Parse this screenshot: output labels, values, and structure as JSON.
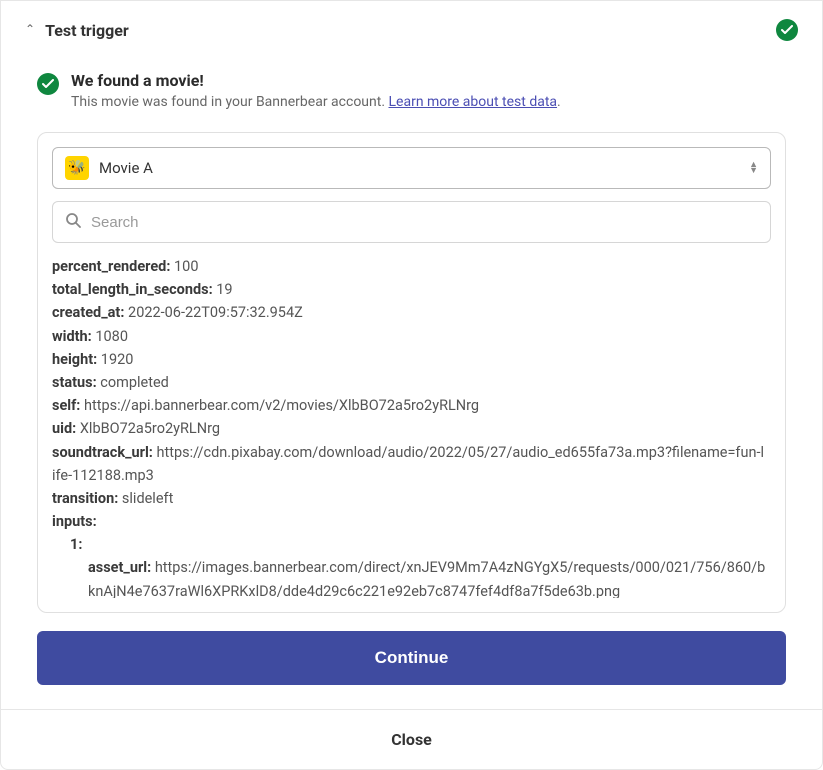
{
  "header": {
    "title": "Test trigger"
  },
  "found": {
    "title": "We found a movie!",
    "sub_prefix": "This movie was found in your Bannerbear account. ",
    "link_text": "Learn more about test data",
    "sub_suffix": "."
  },
  "select": {
    "label": "Movie A"
  },
  "search": {
    "placeholder": "Search"
  },
  "record": {
    "percent_rendered": {
      "k": "percent_rendered:",
      "v": "100"
    },
    "total_length_in_seconds": {
      "k": "total_length_in_seconds:",
      "v": "19"
    },
    "created_at": {
      "k": "created_at:",
      "v": "2022-06-22T09:57:32.954Z"
    },
    "width": {
      "k": "width:",
      "v": "1080"
    },
    "height": {
      "k": "height:",
      "v": "1920"
    },
    "status": {
      "k": "status:",
      "v": "completed"
    },
    "self": {
      "k": "self:",
      "v": "https://api.bannerbear.com/v2/movies/XlbBO72a5ro2yRLNrg"
    },
    "uid": {
      "k": "uid:",
      "v": "XlbBO72a5ro2yRLNrg"
    },
    "soundtrack_url": {
      "k": "soundtrack_url:",
      "v": "https://cdn.pixabay.com/download/audio/2022/05/27/audio_ed655fa73a.mp3?filename=fun-life-112188.mp3"
    },
    "transition": {
      "k": "transition:",
      "v": "slideleft"
    },
    "inputs": {
      "k": "inputs:"
    },
    "input1": {
      "k": "1:"
    },
    "asset_url": {
      "k": "asset_url:",
      "v": "https://images.bannerbear.com/direct/xnJEV9Mm7A4zNGYgX5/requests/000/021/756/860/bknAjN4e7637raWl6XPRKxlD8/dde4d29c6c221e92eb7c8747fef4df8a7f5de63b.png"
    }
  },
  "buttons": {
    "continue": "Continue",
    "close": "Close"
  }
}
